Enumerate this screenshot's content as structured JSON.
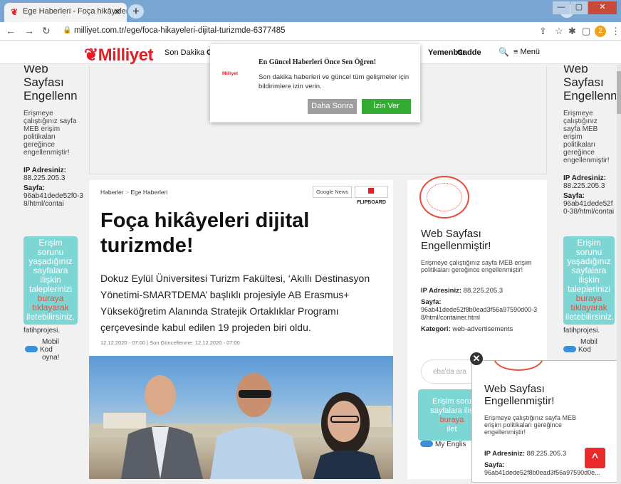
{
  "browser": {
    "tab_title": "Ege Haberleri - Foça hikâyeleri di",
    "new_tab": "+",
    "url": "milliyet.com.tr/ege/foca-hikayeleri-dijital-turizmde-6377485",
    "avatar_letter": "2",
    "window_controls": [
      "—",
      "▢",
      "✕"
    ]
  },
  "site": {
    "logo": "Milliyet",
    "nav_son_dakika": "Son Dakika",
    "nav_partial": "G",
    "nav_yemenbar": "Yemenbar",
    "nav_cadde": "Cadde",
    "nav_menu": "≡ Menü",
    "accent": "#e31e24"
  },
  "blocked": {
    "title": "Web Sayfası Engellenmiştir!",
    "title_left": "Web\nSayfası\nEngellenn",
    "message_narrow": "Erişmeye çalıştığınız sayfa MEB erişim politikaları gereğince engellenmiştir!",
    "ip_label": "IP Adresiniz:",
    "ip_value": "88.225.205.3",
    "page_label": "Sayfa:",
    "page_value_narrow": "96ab41dede52f0-38/html/contai",
    "page_value_card": "96ab41dede52f8b0ead3f56a97590d00-38/html/container.html",
    "page_value_float": "96ab41dede52f8b0ead3f56a97590d0e...",
    "kategori_label": "Kategori:",
    "kategori_value": "web-advertisements",
    "teal_line1": "Erişim sorunu yaşadığınız sayfalara ilişkin taleplerinizi",
    "teal_link": "buraya tıklayarak",
    "teal_line2": "iletebilirsiniz.",
    "teal_card_text": "Erişim soru sayfalara iliş",
    "teal_card_link": "buraya",
    "teal_card_end": "ilet",
    "fatih": "fatihprojesi.",
    "mobil_line1": "Mobil",
    "mobil_line2": "Kod",
    "mobil_line3": "oyna!",
    "search_placeholder": "eba'da ara",
    "my_english": "My Englis"
  },
  "popup": {
    "title": "En Güncel Haberleri Önce Sen Öğren!",
    "logo": "Milliyet",
    "text": "Son dakika haberleri ve güncel tüm gelişmeler için bildirimlere izin verin.",
    "later_label": "Daha Sonra",
    "allow_label": "İzin Ver"
  },
  "article": {
    "breadcrumb_1": "Haberler",
    "breadcrumb_sep": ">",
    "breadcrumb_2": "Ege Haberleri",
    "google_news": "Google News",
    "flipboard": "FLIPBOARD",
    "headline": "Foça hikâyeleri dijital turizmde!",
    "summary": "Dokuz Eylül Üniversitesi Turizm Fakültesi, ‘Akıllı Destinasyon Yönetimi-SMARTDEMA’ başlıklı projesiyle AB Erasmus+ Yükseköğretim Alanında Stratejik Ortaklıklar Programı çerçevesinde kabul edilen 19 projeden biri oldu.",
    "dates": "12.12.2020 - 07:00 | Son Güncellenme: 12.12.2020 - 07:00"
  },
  "floating": {
    "close": "✕",
    "scroll_top": "^"
  }
}
